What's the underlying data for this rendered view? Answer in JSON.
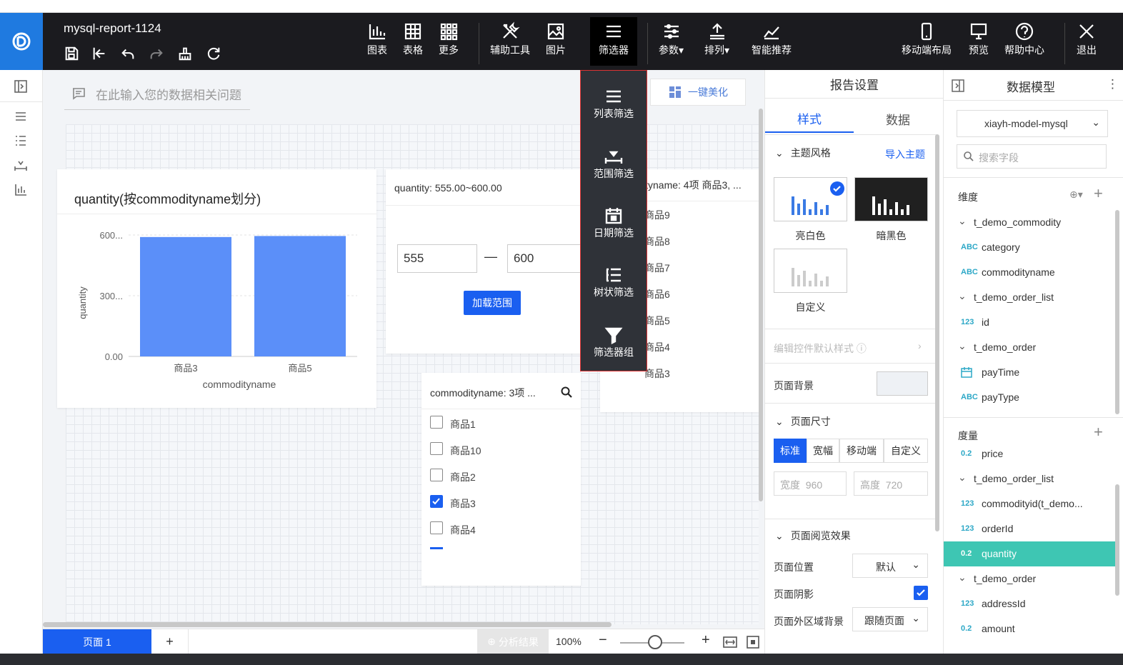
{
  "app": {
    "report_title": "mysql-report-1124"
  },
  "toolbar": {
    "chart": "图表",
    "table": "表格",
    "more": "更多",
    "aux": "辅助工具",
    "image": "图片",
    "filter": "筛选器",
    "params": "参数",
    "arrange": "排列",
    "smart": "智能推荐",
    "mobile": "移动端布局",
    "preview": "预览",
    "help": "帮助中心",
    "exit": "退出"
  },
  "question": {
    "placeholder": "在此输入您的数据相关问题"
  },
  "beautify": "一键美化",
  "filter_menu": [
    "列表筛选",
    "范围筛选",
    "日期筛选",
    "树状筛选",
    "筛选器组"
  ],
  "chart_card": {
    "title": "quantity(按commodityname划分)"
  },
  "chart_data": {
    "type": "bar",
    "categories": [
      "商品3",
      "商品5"
    ],
    "values": [
      590,
      595
    ],
    "xlabel": "commodityname",
    "ylabel": "quantity",
    "yticks": [
      "600...",
      "300...",
      "0.00"
    ],
    "ylim": [
      0,
      600
    ]
  },
  "range_card": {
    "title": "quantity: 555.00~600.00",
    "min": "555",
    "max": "600",
    "dash": "—",
    "button": "加载范围"
  },
  "list_card": {
    "title": "commodityname: 3项 ...",
    "items": [
      {
        "label": "商品1",
        "checked": false
      },
      {
        "label": "商品10",
        "checked": false
      },
      {
        "label": "商品2",
        "checked": false
      },
      {
        "label": "商品3",
        "checked": true
      },
      {
        "label": "商品4",
        "checked": false
      }
    ]
  },
  "list_card2": {
    "title": "ityname: 4项 商品3, ...",
    "items": [
      "商品9",
      "商品8",
      "商品7",
      "商品6",
      "商品5",
      "商品4",
      "商品3"
    ]
  },
  "settings": {
    "title": "报告设置",
    "tab_style": "样式",
    "tab_data": "数据",
    "theme_section": "主题风格",
    "import_theme": "导入主题",
    "theme_light": "亮白色",
    "theme_dark": "暗黑色",
    "theme_custom": "自定义",
    "edit_default": "编辑控件默认样式",
    "page_bg": "页面背景",
    "page_size": "页面尺寸",
    "sizes": [
      "标准",
      "宽幅",
      "移动端",
      "自定义"
    ],
    "width_label": "宽度",
    "width_value": "960",
    "height_label": "高度",
    "height_value": "720",
    "browse": "页面阅览效果",
    "position_label": "页面位置",
    "position_value": "默认",
    "shadow_label": "页面阴影",
    "outer_bg_label": "页面外区域背景",
    "outer_bg_value": "跟随页面"
  },
  "model": {
    "title": "数据模型",
    "selected_model": "xiayh-model-mysql",
    "search_placeholder": "搜索字段",
    "dimensions": "维度",
    "measures": "度量",
    "dim_items": [
      {
        "kind": "table",
        "name": "t_demo_commodity"
      },
      {
        "kind": "field",
        "tag": "ABC",
        "name": "category"
      },
      {
        "kind": "field",
        "tag": "ABC",
        "name": "commodityname"
      },
      {
        "kind": "table",
        "name": "t_demo_order_list"
      },
      {
        "kind": "field",
        "tag": "123",
        "name": "id"
      },
      {
        "kind": "table",
        "name": "t_demo_order"
      },
      {
        "kind": "field",
        "tag": "cal",
        "name": "payTime"
      },
      {
        "kind": "field",
        "tag": "ABC",
        "name": "payType"
      }
    ],
    "mea_items": [
      {
        "kind": "field",
        "tag": "0.2",
        "name": "price"
      },
      {
        "kind": "table",
        "name": "t_demo_order_list"
      },
      {
        "kind": "field",
        "tag": "123",
        "name": "commodityid(t_demo..."
      },
      {
        "kind": "field",
        "tag": "123",
        "name": "orderId"
      },
      {
        "kind": "field",
        "tag": "0.2",
        "name": "quantity",
        "selected": true
      },
      {
        "kind": "table",
        "name": "t_demo_order"
      },
      {
        "kind": "field",
        "tag": "123",
        "name": "addressId"
      },
      {
        "kind": "field",
        "tag": "0.2",
        "name": "amount"
      }
    ]
  },
  "bottom": {
    "page_tab": "页面 1",
    "add": "+",
    "analysis": "分析结果",
    "zoom": "100%",
    "minus": "−",
    "plus": "+"
  },
  "colors": {
    "accent": "#1a5ff0",
    "bar": "#5b8ff9",
    "selected_row": "#3ec6b3"
  }
}
